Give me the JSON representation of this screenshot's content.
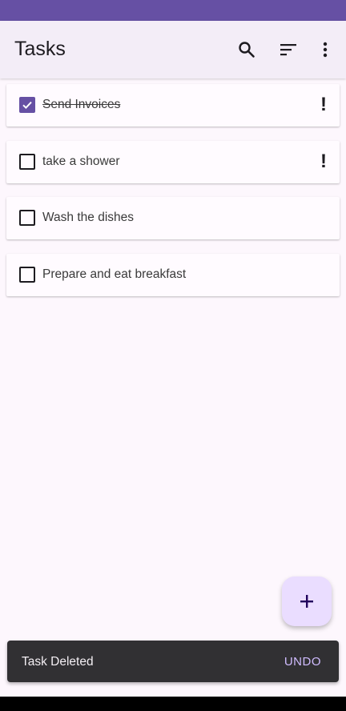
{
  "app": {
    "title": "Tasks"
  },
  "toolbar": {
    "icons": [
      "search-icon",
      "sort-icon",
      "more-vert-icon"
    ]
  },
  "tasks": [
    {
      "label": "Send Invoices",
      "checked": true,
      "important": true,
      "priority_mark": "!"
    },
    {
      "label": "take a shower",
      "checked": false,
      "important": true,
      "priority_mark": "!"
    },
    {
      "label": "Wash the dishes",
      "checked": false,
      "important": false
    },
    {
      "label": "Prepare and eat breakfast",
      "checked": false,
      "important": false
    }
  ],
  "fab": {
    "icon": "plus-icon"
  },
  "snackbar": {
    "message": "Task Deleted",
    "action": "UNDO"
  },
  "colors": {
    "primary": "#6650a4",
    "appbar": "#f3edf7",
    "background": "#fdf7fd",
    "fab": "#eaddff",
    "snackbar": "#313033",
    "snackbar_action": "#d0bcff"
  }
}
